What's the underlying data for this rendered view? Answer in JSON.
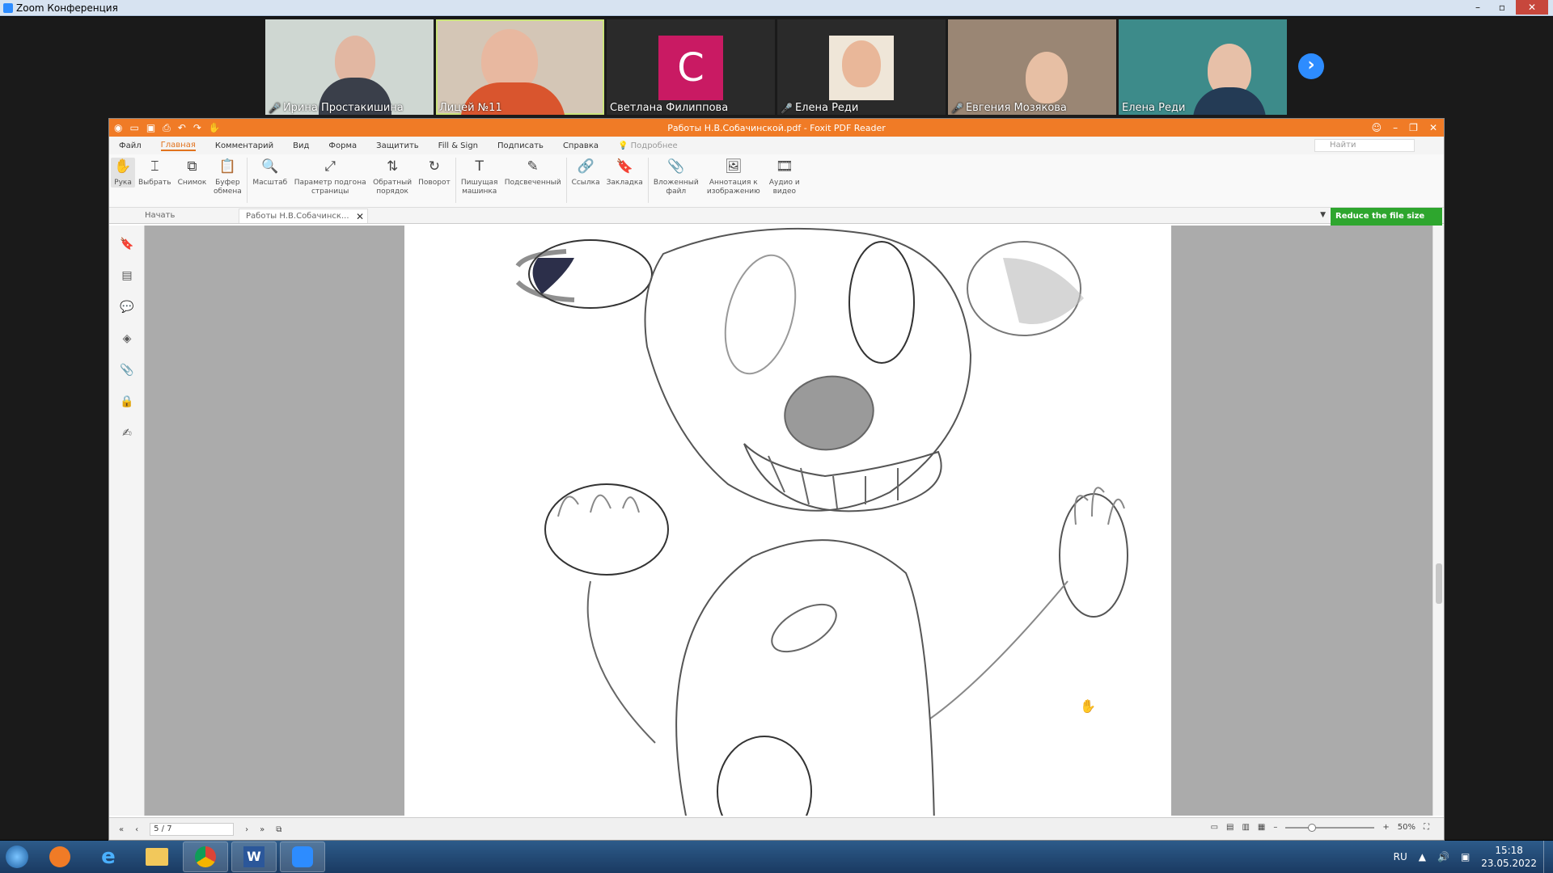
{
  "zoom": {
    "window_title": "Zoom Конференция",
    "participants": [
      {
        "name": "Ирина Простакишина",
        "muted": true
      },
      {
        "name": "Лицей №11",
        "muted": false,
        "active": true
      },
      {
        "name": "Светлана Филиппова",
        "muted": false,
        "initial": "С"
      },
      {
        "name": "Елена Реди",
        "muted": true
      },
      {
        "name": "Евгения Мозякова",
        "muted": true
      },
      {
        "name": "Елена Реди",
        "muted": false
      }
    ]
  },
  "foxit": {
    "title": "Работы Н.В.Собачинской.pdf - Foxit PDF Reader",
    "menu": [
      "Файл",
      "Главная",
      "Комментарий",
      "Вид",
      "Форма",
      "Защитить",
      "Fill & Sign",
      "Подписать",
      "Справка"
    ],
    "help_hint": "Подробнее",
    "search_placeholder": "Найти",
    "tools": [
      {
        "icon": "✋",
        "label": "Рука"
      },
      {
        "icon": "⌶",
        "label": "Выбрать"
      },
      {
        "icon": "⧉",
        "label": "Снимок"
      },
      {
        "icon": "📋",
        "label": "Буфер обмена"
      },
      {
        "icon": "🔍",
        "label": "Масштаб"
      },
      {
        "icon": "⤢",
        "label": "Параметр подгона страницы"
      },
      {
        "icon": "⇅",
        "label": "Обратный порядок"
      },
      {
        "icon": "↻",
        "label": "Поворот"
      },
      {
        "icon": "T",
        "label": "Пишущая машинка"
      },
      {
        "icon": "✎",
        "label": "Подсвеченный"
      },
      {
        "icon": "🔗",
        "label": "Ссылка"
      },
      {
        "icon": "🔖",
        "label": "Закладка"
      },
      {
        "icon": "📎",
        "label": "Вложенный файл"
      },
      {
        "icon": "🖼",
        "label": "Аннотация к изображению"
      },
      {
        "icon": "🎞",
        "label": "Аудио и видео"
      }
    ],
    "tabs": {
      "start": "Начать",
      "doc": "Работы Н.В.Собачинск..."
    },
    "reduce_button": "Reduce the file size",
    "status": {
      "page": "5 / 7",
      "zoom": "50%"
    }
  },
  "taskbar": {
    "lang": "RU",
    "time": "15:18",
    "date": "23.05.2022"
  }
}
